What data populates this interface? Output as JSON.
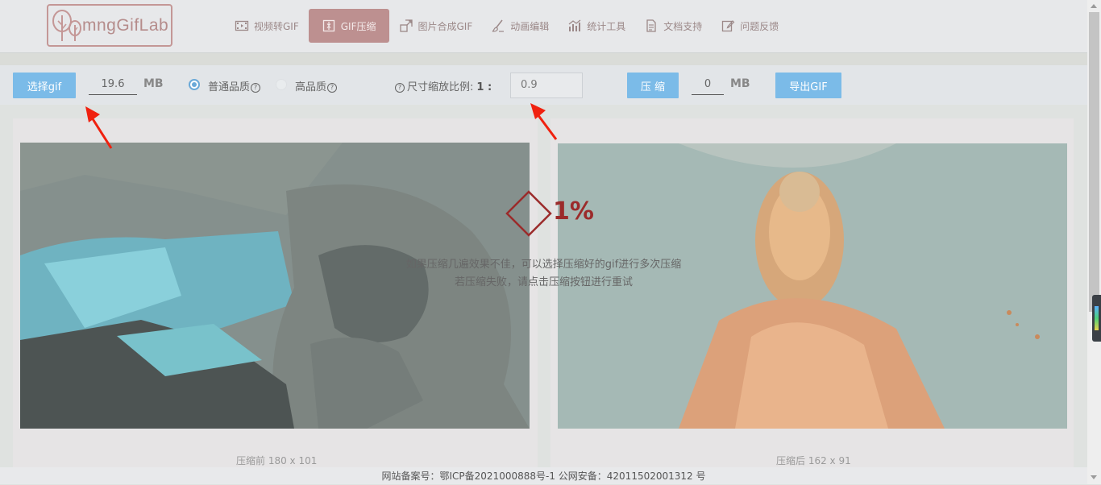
{
  "header": {
    "logo_text": "mngGifLab",
    "nav": [
      {
        "label": "视频转GIF",
        "icon": "film-icon"
      },
      {
        "label": "GIF压缩",
        "icon": "compress-icon",
        "active": true
      },
      {
        "label": "图片合成GIF",
        "icon": "merge-icon"
      },
      {
        "label": "动画编辑",
        "icon": "brush-icon"
      },
      {
        "label": "统计工具",
        "icon": "bar-chart-icon"
      },
      {
        "label": "文档支持",
        "icon": "document-icon"
      },
      {
        "label": "问题反馈",
        "icon": "edit-icon"
      }
    ]
  },
  "toolbar": {
    "select_label": "选择gif",
    "original_size": "19.6",
    "size_unit": "MB",
    "quality_normal": "普通品质",
    "quality_high": "高品质",
    "help_glyph": "?",
    "scale_label": "尺寸缩放比例:",
    "scale_prefix": "1 :",
    "scale_value": "0.9",
    "compress_label": "压 缩",
    "compressed_size": "0",
    "compressed_unit": "MB",
    "export_label": "导出GIF"
  },
  "preview": {
    "before_caption": "压缩前 180 x 101",
    "after_caption": "压缩后 162 x 91"
  },
  "overlay": {
    "progress": "1%",
    "line1": "如果压缩几遍效果不佳，可以选择压缩好的gif进行多次压缩",
    "line2": "若压缩失败，请点击压缩按钮进行重试"
  },
  "footer": {
    "text": "网站备案号：鄂ICP备2021000888号-1 公网安备：42011502001312 号"
  },
  "colors": {
    "accent_button": "#7bbbe8",
    "nav_active": "#bd9090",
    "progress_red": "#9b2b2b"
  }
}
